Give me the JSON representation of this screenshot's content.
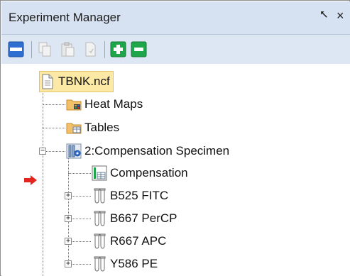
{
  "panel": {
    "title": "Experiment Manager",
    "pin_glyph": "⭦",
    "close_glyph": "×"
  },
  "toolbar": {
    "buttons": [
      "panel-toggle-icon",
      "copy-icon",
      "paste-icon",
      "document-icon",
      "add-icon",
      "remove-icon"
    ]
  },
  "tree": {
    "root": {
      "label": "TBNK.ncf",
      "icon": "document-icon",
      "selected": true
    },
    "heat_maps": {
      "label": "Heat Maps",
      "icon": "folder-icon"
    },
    "tables": {
      "label": "Tables",
      "icon": "folder-icon"
    },
    "specimen": {
      "label": "2:Compensation Specimen",
      "icon": "specimen-icon",
      "expander": "−"
    },
    "compensation": {
      "label": "Compensation",
      "icon": "worksheet-icon"
    },
    "tubes": [
      {
        "label": "B525 FITC",
        "icon": "tube-icon",
        "expander": "+",
        "current": true
      },
      {
        "label": "B667 PerCP",
        "icon": "tube-icon",
        "expander": "+"
      },
      {
        "label": "R667 APC",
        "icon": "tube-icon",
        "expander": "+"
      },
      {
        "label": "Y586 PE",
        "icon": "tube-icon",
        "expander": "+"
      }
    ]
  },
  "colors": {
    "header_bg": "#d6e2f1",
    "selection": "#fde9a6",
    "add_green": "#1ea64a",
    "accent_blue": "#2f6fd1",
    "pointer_red": "#e2261f"
  }
}
